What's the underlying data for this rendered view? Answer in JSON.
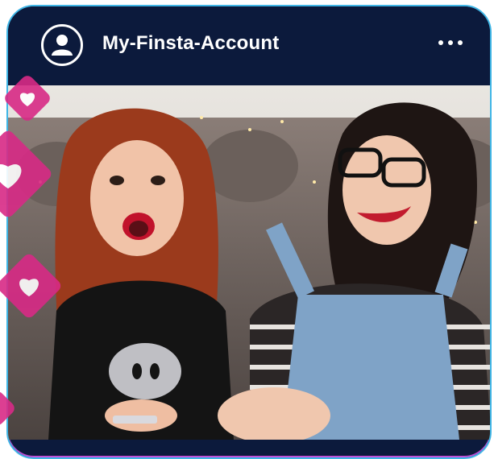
{
  "post": {
    "username": "My-Finsta-Account",
    "avatar_icon": "user-icon",
    "more_icon": "more-horizontal-icon"
  },
  "overlay": {
    "reaction_icon": "heart-icon",
    "accent_color": "#d82a86"
  },
  "colors": {
    "header_bg": "#0c1a3c",
    "frame_border": "#3fb6e6"
  }
}
